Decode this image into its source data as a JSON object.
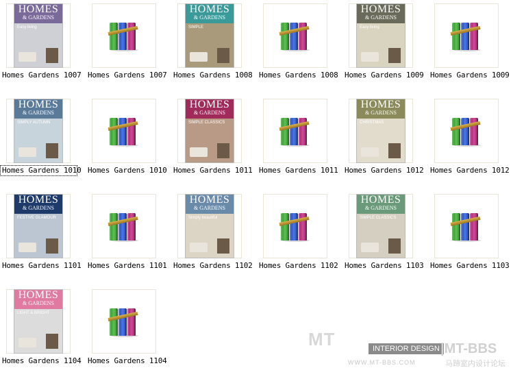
{
  "files": [
    {
      "label": "Homes Gardens 1007",
      "kind": "cover",
      "mast": "#7a6a9a",
      "pic": "#cfcfd6",
      "line": "Easy living"
    },
    {
      "label": "Homes Gardens 1007",
      "kind": "archive"
    },
    {
      "label": "Homes Gardens 1008",
      "kind": "cover",
      "mast": "#3a9a9a",
      "pic": "#a89a7a",
      "line": "SIMPLE"
    },
    {
      "label": "Homes Gardens 1008",
      "kind": "archive"
    },
    {
      "label": "Homes Gardens 1009",
      "kind": "cover",
      "mast": "#6a6a5a",
      "pic": "#d8d4c0",
      "line": "Easy living"
    },
    {
      "label": "Homes Gardens 1009",
      "kind": "archive"
    },
    {
      "label": "Homes Gardens 1010",
      "kind": "cover",
      "mast": "#5a7a9a",
      "pic": "#c8d4dc",
      "line": "SIMPLY AUTUMN",
      "selected": true
    },
    {
      "label": "Homes Gardens 1010",
      "kind": "archive"
    },
    {
      "label": "Homes Gardens 1011",
      "kind": "cover",
      "mast": "#a02a5a",
      "pic": "#b89a86",
      "line": "SIMPLE CLASSICS"
    },
    {
      "label": "Homes Gardens 1011",
      "kind": "archive"
    },
    {
      "label": "Homes Gardens 1012",
      "kind": "cover",
      "mast": "#8a8a5a",
      "pic": "#e2dccc",
      "line": "CHRISTMAS"
    },
    {
      "label": "Homes Gardens 1012",
      "kind": "archive"
    },
    {
      "label": "Homes Gardens 1101",
      "kind": "cover",
      "mast": "#1e3a6a",
      "pic": "#bcc6d2",
      "line": "FESTIVE GLAMOUR"
    },
    {
      "label": "Homes Gardens 1101",
      "kind": "archive"
    },
    {
      "label": "Homes Gardens 1102",
      "kind": "cover",
      "mast": "#6a8aaa",
      "pic": "#dcd4c4",
      "line": "Simply beautiful"
    },
    {
      "label": "Homes Gardens 1102",
      "kind": "archive"
    },
    {
      "label": "Homes Gardens 1103",
      "kind": "cover",
      "mast": "#6a9a7a",
      "pic": "#d4cfc0",
      "line": "SIMPLE CLASSICS"
    },
    {
      "label": "Homes Gardens 1103",
      "kind": "archive"
    },
    {
      "label": "Homes Gardens 1104",
      "kind": "cover",
      "mast": "#e07aa0",
      "pic": "#dcdcdc",
      "line": "LIGHT & BRIGHT"
    },
    {
      "label": "Homes Gardens 1104",
      "kind": "archive"
    }
  ],
  "cover_title": "HOMES",
  "cover_subtitle": "& GARDENS",
  "watermark": {
    "logo": "MT",
    "badge": "INTERIOR DESIGN",
    "url": "WWW.MT-BBS.COM",
    "bbs": "|MT-BBS",
    "cn": "马蹄室内设计论坛"
  }
}
